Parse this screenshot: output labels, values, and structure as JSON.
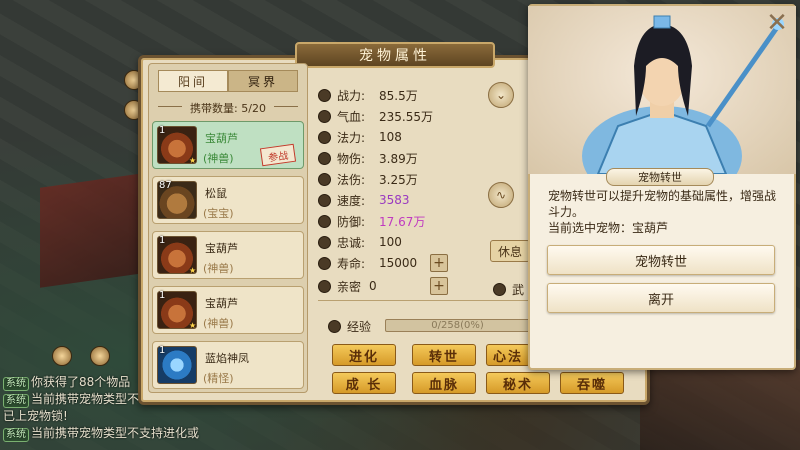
{
  "panel": {
    "title": "宠物属性",
    "tabs": [
      "阳间",
      "冥界"
    ],
    "carry_label": "携带数量: 5/20"
  },
  "pets": [
    {
      "count": "1",
      "name": "宝葫芦",
      "type": "(神兽)",
      "badge": "★",
      "stamp": "参战",
      "selected": true
    },
    {
      "count": "87",
      "name": "松鼠",
      "type": "(宝宝)",
      "badge": "",
      "stamp": "",
      "selected": false
    },
    {
      "count": "1",
      "name": "宝葫芦",
      "type": "(神兽)",
      "badge": "★",
      "stamp": "",
      "selected": false
    },
    {
      "count": "1",
      "name": "宝葫芦",
      "type": "(神兽)",
      "badge": "★",
      "stamp": "",
      "selected": false
    },
    {
      "count": "1",
      "name": "蓝焰神凤",
      "type": "(精怪)",
      "badge": "",
      "stamp": "",
      "selected": false
    }
  ],
  "stats": [
    {
      "label": "战力:",
      "value": "85.5万",
      "color": "#3a2a16"
    },
    {
      "label": "气血:",
      "value": "235.55万",
      "color": "#3a2a16"
    },
    {
      "label": "法力:",
      "value": "108",
      "color": "#3a2a16"
    },
    {
      "label": "物伤:",
      "value": "3.89万",
      "color": "#3a2a16"
    },
    {
      "label": "法伤:",
      "value": "3.25万",
      "color": "#3a2a16"
    },
    {
      "label": "速度:",
      "value": "3583",
      "color": "#9a3ac0"
    },
    {
      "label": "防御:",
      "value": "17.67万",
      "color": "#c03ac0"
    },
    {
      "label": "忠诚:",
      "value": "100",
      "color": "#3a2a16"
    },
    {
      "label": "寿命:",
      "value": "15000",
      "color": "#3a2a16"
    }
  ],
  "intimacy": {
    "label": "亲密",
    "value": "0"
  },
  "wu_label": "武",
  "side_button": "休息",
  "experience": {
    "label": "经验",
    "value": "0/258(0%)"
  },
  "actions_row1": [
    "进化",
    "转世",
    "心法"
  ],
  "actions_row2": [
    "成 长",
    "血脉",
    "秘术",
    "吞噬"
  ],
  "chat": [
    {
      "tag": "系统",
      "text": "你获得了88个物品"
    },
    {
      "tag": "系统",
      "text": "当前携带宠物类型不"
    },
    {
      "tag": "",
      "text": "已上宠物锁!"
    },
    {
      "tag": "系统",
      "text": "当前携带宠物类型不支持进化或"
    }
  ],
  "dialog": {
    "npc_name": "宠物转世",
    "description": "宠物转世可以提升宠物的基础属性，增强战斗力。",
    "current_pet": "当前选中宠物：宝葫芦",
    "button_primary": "宠物转世",
    "button_leave": "离开",
    "close_symbol": "✕"
  }
}
